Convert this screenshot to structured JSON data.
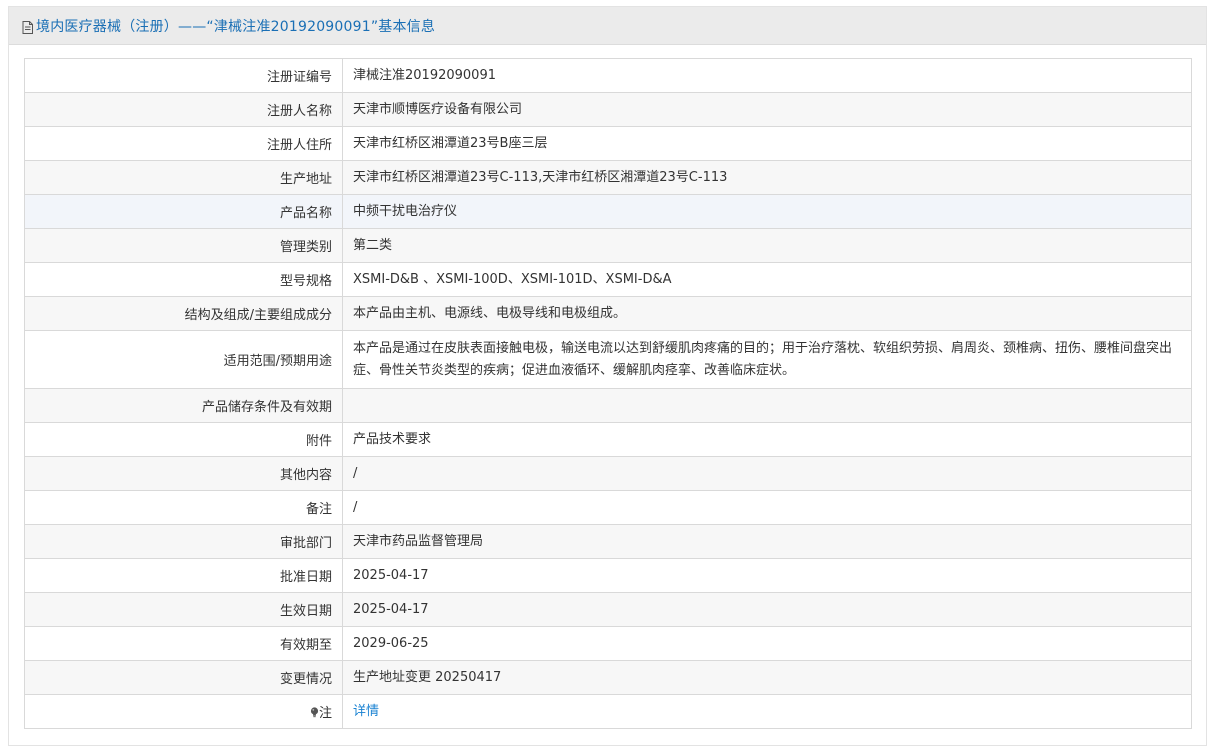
{
  "header": {
    "title": "境内医疗器械（注册）——“津械注准20192090091”基本信息",
    "icon": "document-icon"
  },
  "rows": [
    {
      "label": "注册证编号",
      "value": "津械注准20192090091"
    },
    {
      "label": "注册人名称",
      "value": "天津市顺博医疗设备有限公司"
    },
    {
      "label": "注册人住所",
      "value": "天津市红桥区湘潭道23号B座三层"
    },
    {
      "label": "生产地址",
      "value": "天津市红桥区湘潭道23号C-113,天津市红桥区湘潭道23号C-113"
    },
    {
      "label": "产品名称",
      "value": "中频干扰电治疗仪"
    },
    {
      "label": "管理类别",
      "value": "第二类"
    },
    {
      "label": "型号规格",
      "value": "XSMI-D&B 、XSMI-100D、XSMI-101D、XSMI-D&A"
    },
    {
      "label": "结构及组成/主要组成成分",
      "value": "本产品由主机、电源线、电极导线和电极组成。"
    },
    {
      "label": "适用范围/预期用途",
      "value": "本产品是通过在皮肤表面接触电极，输送电流以达到舒缓肌肉疼痛的目的；用于治疗落枕、软组织劳损、肩周炎、颈椎病、扭伤、腰椎间盘突出症、骨性关节炎类型的疾病；促进血液循环、缓解肌肉痉挛、改善临床症状。"
    },
    {
      "label": "产品储存条件及有效期",
      "value": ""
    },
    {
      "label": "附件",
      "value": "产品技术要求"
    },
    {
      "label": "其他内容",
      "value": "/"
    },
    {
      "label": "备注",
      "value": "/"
    },
    {
      "label": "审批部门",
      "value": "天津市药品监督管理局"
    },
    {
      "label": "批准日期",
      "value": "2025-04-17"
    },
    {
      "label": "生效日期",
      "value": "2025-04-17"
    },
    {
      "label": "有效期至",
      "value": "2029-06-25"
    },
    {
      "label": "变更情况",
      "value": "生产地址变更 20250417"
    }
  ],
  "note": {
    "label": "注",
    "icon": "lightbulb-icon",
    "link_text": "详情"
  },
  "colors": {
    "title": "#1a6fb5",
    "link": "#1a82d2",
    "header_bg": "#ebebeb",
    "alt_row_bg": "#f7f7f7",
    "highlight_row_bg": "#f2f5fa",
    "border": "#d9d9d9"
  }
}
